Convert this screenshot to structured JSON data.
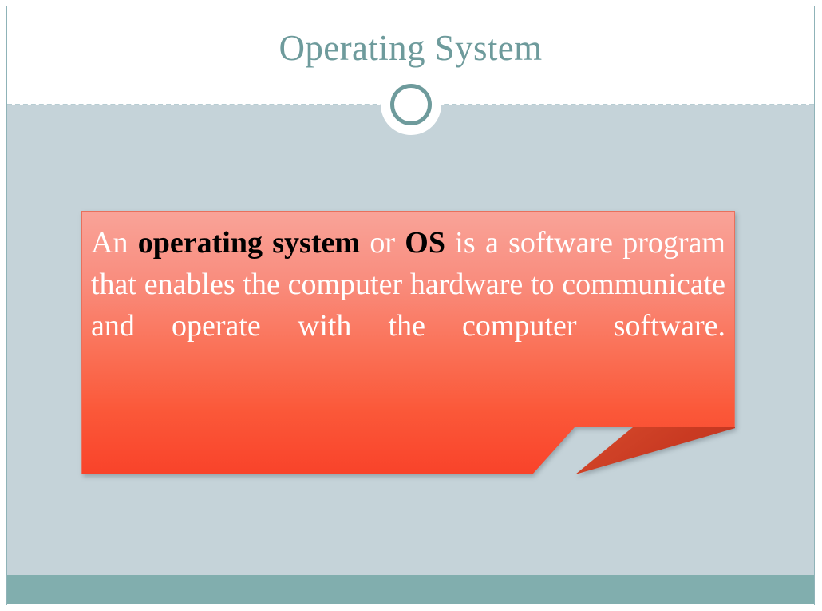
{
  "slide": {
    "title": "Operating System",
    "theme": {
      "title_color": "#6e9b9c",
      "accent_ring_color": "#6e9b9c",
      "body_background": "#c5d3d9",
      "header_background": "#ffffff",
      "footer_bar_color": "#81aeae",
      "divider_color": "#b7ccd2",
      "card_gradient_top": "#f9a398",
      "card_gradient_bottom": "#f9432a",
      "card_fold_color": "#c93a22",
      "card_text_color": "#ffffff",
      "card_emphasis_color": "#000000"
    }
  },
  "content_card": {
    "segments": [
      {
        "text": "An ",
        "bold": false
      },
      {
        "text": "operating system",
        "bold": true
      },
      {
        "text": " or ",
        "bold": false
      },
      {
        "text": "OS",
        "bold": true
      },
      {
        "text": " is a software program that enables the computer hardware to communicate and operate with the computer software.",
        "bold": false
      }
    ],
    "full_text": "An operating system or OS is a software program that enables the computer hardware to communicate and operate with the computer software."
  },
  "decorations": {
    "ring_icon": "circle-outline-icon",
    "divider_icon": "dashed-rule-icon",
    "fold_icon": "page-fold-icon"
  }
}
